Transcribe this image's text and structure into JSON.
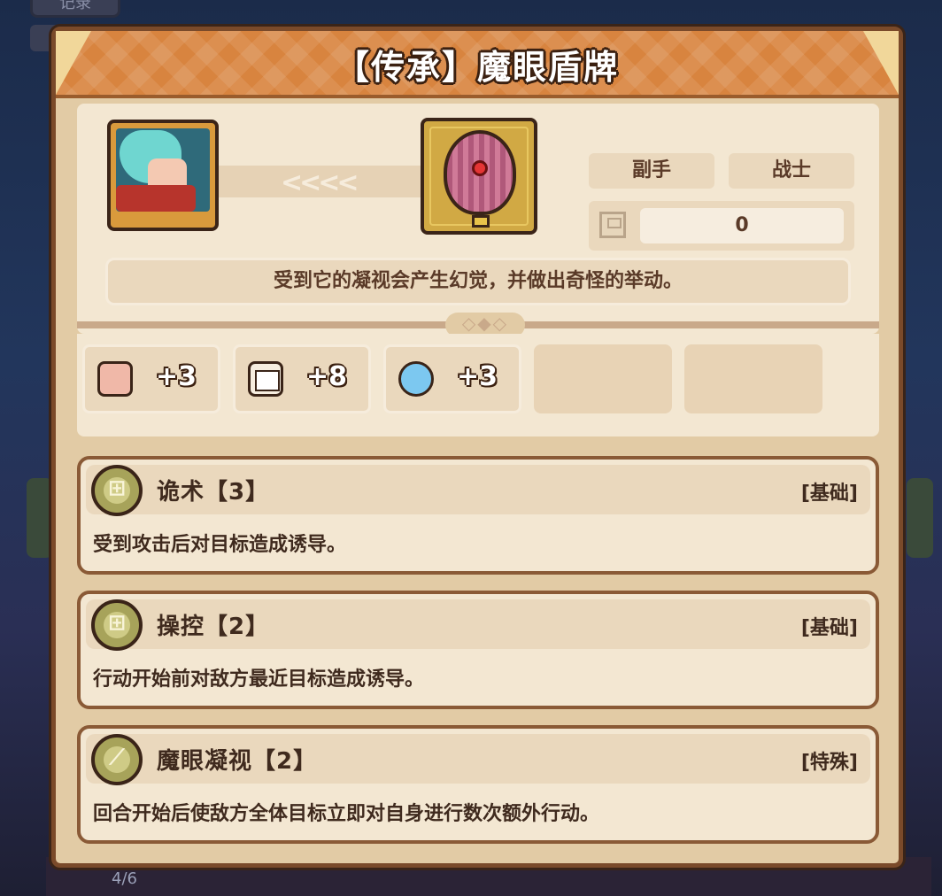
{
  "background": {
    "top_tab_label": "记录",
    "page_indicator": "4/6"
  },
  "item": {
    "title": "【传承】魔眼盾牌",
    "slot": "副手",
    "class": "战士",
    "stat_value": "0",
    "description": "受到它的凝视会产生幻觉，并做出奇怪的举动。"
  },
  "bonuses": [
    {
      "icon": "fist-icon",
      "value": "+3"
    },
    {
      "icon": "book-icon",
      "value": "+8"
    },
    {
      "icon": "water-drop-icon",
      "value": "+3"
    }
  ],
  "skills": [
    {
      "name": "诡术【3】",
      "type": "[基础]",
      "description": "受到攻击后对目标造成诱导。",
      "icon": "rune-icon"
    },
    {
      "name": "操控【2】",
      "type": "[基础]",
      "description": "行动开始前对敌方最近目标造成诱导。",
      "icon": "rune-icon"
    },
    {
      "name": "魔眼凝视【2】",
      "type": "[特殊]",
      "description": "回合开始后使敌方全体目标立即对自身进行数次额外行动。",
      "icon": "feather-icon"
    }
  ],
  "colors": {
    "title_bar": "#d8843f",
    "panel_bg": "#e2cba5",
    "border": "#7a4a2a"
  }
}
